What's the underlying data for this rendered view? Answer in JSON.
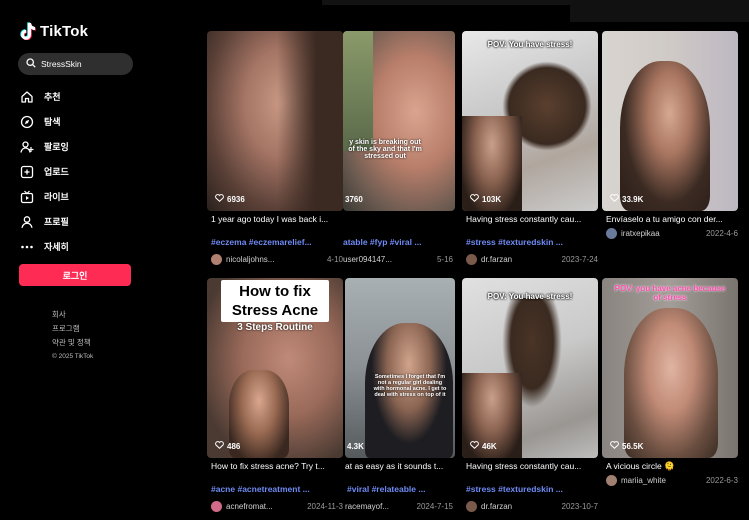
{
  "app": {
    "logo_text": "TikTok"
  },
  "search": {
    "query": "StressSkin"
  },
  "nav": [
    {
      "label": "추천",
      "icon": "home-icon"
    },
    {
      "label": "탐색",
      "icon": "compass-icon"
    },
    {
      "label": "팔로잉",
      "icon": "person-plus-icon"
    },
    {
      "label": "업로드",
      "icon": "upload-icon"
    },
    {
      "label": "라이브",
      "icon": "live-icon"
    },
    {
      "label": "프로필",
      "icon": "person-icon"
    },
    {
      "label": "자세히",
      "icon": "more-dots-icon"
    }
  ],
  "login_label": "로그인",
  "footer": [
    "회사",
    "프로그램",
    "약관 및 정책",
    "© 2025 TikTok"
  ],
  "colors": {
    "accent": "#fe2c55",
    "hashtag": "#6f8bf5"
  },
  "videos": [
    {
      "views": "6936",
      "desc": "1 year ago today I was back i...",
      "tags": "#eczema #eczemarelief...",
      "user": "nicolaljohns...",
      "date": "4-10",
      "overlay": ""
    },
    {
      "views": "3760",
      "desc": "",
      "tags": "atable #fyp #viral ...",
      "user": "user094147...",
      "date": "5-16",
      "overlay": "y skin is breaking out of the sky and that I'm stressed out"
    },
    {
      "views": "103K",
      "desc": "Having stress constantly cau...",
      "tags": "#stress #texturedskin ...",
      "user": "dr.farzan",
      "date": "2023-7-24",
      "overlay": "POV: You have stress!"
    },
    {
      "views": "33.9K",
      "desc": "Envíaselo a tu amigo con der...",
      "tags": "",
      "user": "iratxepikaa",
      "date": "2022-4-6",
      "overlay": ""
    },
    {
      "views": "486",
      "desc": "How to fix stress acne? Try t...",
      "tags": "#acne #acnetreatment ...",
      "user": "acnefromat...",
      "date": "2024-11-3",
      "overlay": "How to fix Stress Acne",
      "overlay2": "3 Steps Routine"
    },
    {
      "views": "4.3K",
      "desc": "at as easy as it sounds t...",
      "tags": "#viral #relateable ...",
      "user": "racemayof...",
      "date": "2024-7-15",
      "overlay": "Sometimes I forget that I'm not a regular girl dealing with hormonal acne. I get to deal with stress on top of it"
    },
    {
      "views": "46K",
      "desc": "Having stress constantly cau...",
      "tags": "#stress #texturedskin ...",
      "user": "dr.farzan",
      "date": "2023-10-7",
      "overlay": "POV: You have stress!"
    },
    {
      "views": "56.5K",
      "desc": "A vicious circle 🫠",
      "tags": "",
      "user": "mariia_white",
      "date": "2022-6-3",
      "overlay": "POV: you have acne because of stress"
    }
  ]
}
